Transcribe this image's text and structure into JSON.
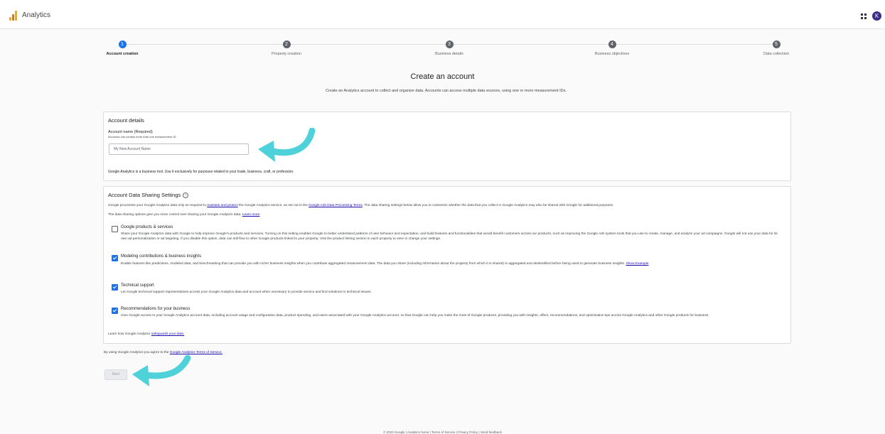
{
  "app": {
    "title": "Analytics",
    "avatar_initial": "K"
  },
  "stepper": [
    {
      "num": "1",
      "label": "Account creation"
    },
    {
      "num": "2",
      "label": "Property creation"
    },
    {
      "num": "3",
      "label": "Business details"
    },
    {
      "num": "4",
      "label": "Business objectives"
    },
    {
      "num": "5",
      "label": "Data collection"
    }
  ],
  "page": {
    "heading": "Create an account",
    "subheading": "Create an Analytics account to collect and organize data. Accounts can access multiple data sources, using one or more measurement IDs."
  },
  "account_details": {
    "title": "Account details",
    "name_label": "Account name (Required)",
    "name_hint": "Accounts can contain more than one measurement ID",
    "name_value": "My New Account Name",
    "notice": "Google Analytics is a business tool. Use it exclusively for purposes related to your trade, business, craft, or profession."
  },
  "sharing": {
    "title": "Account Data Sharing Settings",
    "intro_a": "Google processes your Google Analytics data only as required to ",
    "intro_link1": "maintain and protect",
    "intro_b": " the Google Analytics service, as set out in the ",
    "intro_link2": "Google Ads Data Processing Terms",
    "intro_c": ". The data sharing settings below allow you to customize whether the data that you collect in Google Analytics may also be shared with Google for additional purposes.",
    "control_text": "The data sharing options give you more control over sharing your Google Analytics data. ",
    "control_link": "Learn more",
    "options": [
      {
        "title": "Google products & services",
        "checked": false,
        "desc": "Share your Google Analytics data with Google to help improve Google's products and services. Turning on this setting enables Google to better understand patterns of user behavior and expectation, and build features and functionalities that would benefit customers across our products, such as improving the Google Ads system tools that you use to create, manage, and analyze your ad campaigns. Google will not use your data for its own ad personalization or ad targeting. If you disable this option, data can still flow to other Google products linked to your property. Visit the product linking section in each property to view or change your settings.",
        "link": ""
      },
      {
        "title": "Modeling contributions & business insights",
        "checked": true,
        "desc": "Enable features like predictions, modeled data, and benchmarking that can provide you with richer business insights when you contribute aggregated measurement data. The data you share (including information about the property from which it is shared) is aggregated and deidentified before being used to generate business insights. ",
        "link": "Show Example"
      },
      {
        "title": "Technical support",
        "checked": true,
        "desc": "Let Google technical support representatives access your Google Analytics data and account when necessary to provide service and find solutions to technical issues.",
        "link": ""
      },
      {
        "title": "Recommendations for your business",
        "checked": true,
        "desc": "Give Google access to your Google Analytics account data, including account usage and configuration data, product spending, and users associated with your Google Analytics account, so that Google can help you make the most of Google products, providing you with insights, offers, recommendations, and optimization tips across Google Analytics and other Google products for business.",
        "link": ""
      }
    ],
    "safeguard_text": "Learn how Google Analytics ",
    "safeguard_link": "safeguards your data."
  },
  "terms": {
    "text": "By using Google Analytics you agree to the ",
    "link": "Google Analytics Terms of Service."
  },
  "next_label": "Next",
  "footer": "© 2023 Google | Analytics home | Terms of Service | Privacy Policy | Send feedback",
  "colors": {
    "primary": "#1a73e8",
    "arrow": "#4fd1d9"
  }
}
